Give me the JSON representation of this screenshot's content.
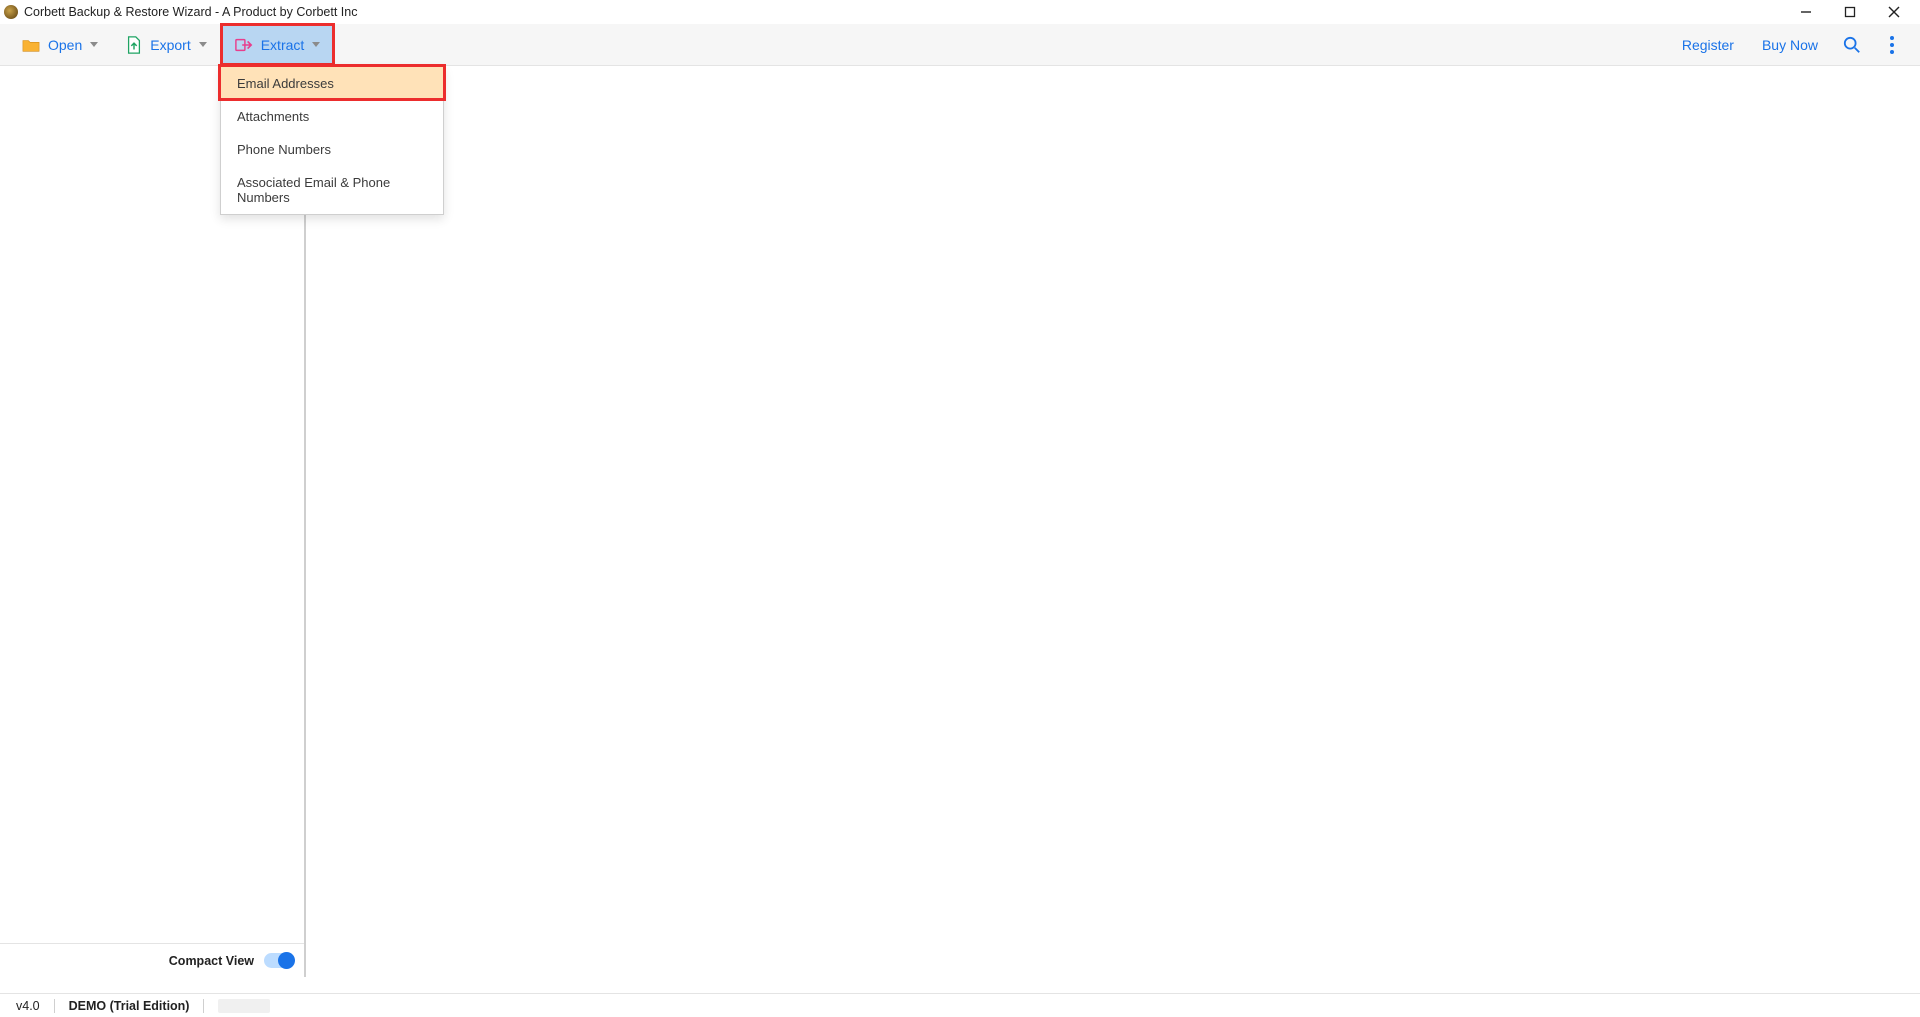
{
  "title": "Corbett Backup & Restore Wizard - A Product by Corbett Inc",
  "toolbar": {
    "open": "Open",
    "export": "Export",
    "extract": "Extract",
    "register": "Register",
    "buy_now": "Buy Now"
  },
  "extract_menu": {
    "items": [
      "Email Addresses",
      "Attachments",
      "Phone Numbers",
      "Associated Email & Phone Numbers"
    ]
  },
  "sidebar": {
    "compact_view": "Compact View",
    "toggle_on": true
  },
  "statusbar": {
    "version": "v4.0",
    "edition": "DEMO (Trial Edition)"
  }
}
